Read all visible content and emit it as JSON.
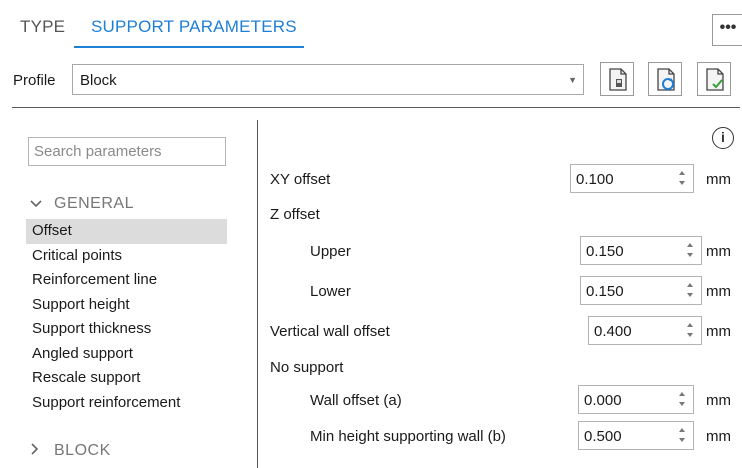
{
  "tabs": [
    {
      "label": "TYPE"
    },
    {
      "label": "SUPPORT PARAMETERS",
      "active": true
    }
  ],
  "more_label": "•••",
  "profile": {
    "label": "Profile",
    "value": "Block"
  },
  "icons": [
    "document-icon",
    "document-refresh-icon",
    "document-check-icon",
    "more-icon",
    "info-icon",
    "chevron-down-icon",
    "chevron-right-icon"
  ],
  "search": {
    "placeholder": "Search parameters"
  },
  "tree": {
    "general": {
      "label": "GENERAL",
      "items": [
        "Offset",
        "Critical points",
        "Reinforcement line",
        "Support height",
        "Support thickness",
        "Angled support",
        "Rescale support",
        "Support reinforcement"
      ],
      "selected": "Offset"
    },
    "block": {
      "label": "BLOCK"
    }
  },
  "info_symbol": "i",
  "params": {
    "xy_offset": {
      "label": "XY offset",
      "value": "0.100",
      "unit": "mm"
    },
    "z_offset": {
      "label": "Z offset"
    },
    "upper": {
      "label": "Upper",
      "value": "0.150",
      "unit": "mm"
    },
    "lower": {
      "label": "Lower",
      "value": "0.150",
      "unit": "mm"
    },
    "vertical_wall_offset": {
      "label": "Vertical wall offset",
      "value": "0.400",
      "unit": "mm"
    },
    "no_support": {
      "label": "No support"
    },
    "wall_offset_a": {
      "label": "Wall offset (a)",
      "value": "0.000",
      "unit": "mm"
    },
    "min_height_wall_b": {
      "label": "Min height supporting wall (b)",
      "value": "0.500",
      "unit": "mm"
    }
  },
  "colors": {
    "accent": "#1f7fd6",
    "selection": "#dcdcdc"
  }
}
